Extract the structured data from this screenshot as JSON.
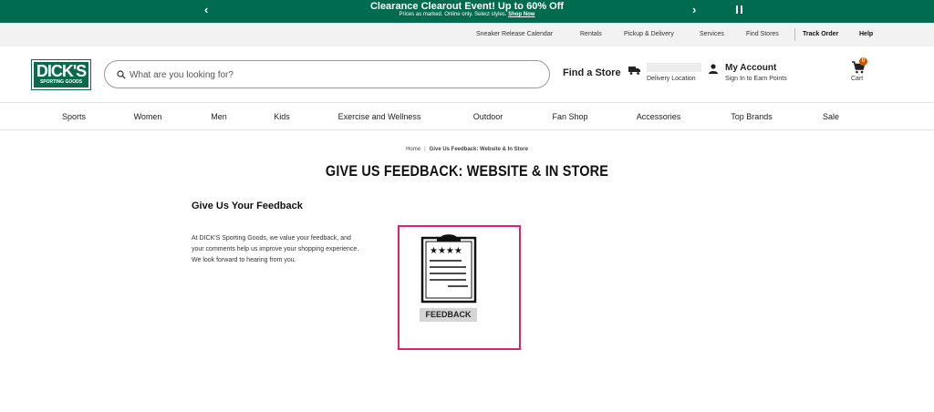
{
  "promo": {
    "title": "Clearance Clearout Event! Up to 60% Off",
    "subtitle": "Prices as marked. Online only. Select styles.",
    "link": "Shop Now",
    "prev": "‹",
    "next": "›"
  },
  "utility": {
    "items": [
      "Sneaker Release Calendar",
      "Rentals",
      "Pickup & Delivery",
      "Services",
      "Find Stores"
    ],
    "track_order": "Track Order",
    "help": "Help"
  },
  "header": {
    "logo_text": "DICK'S",
    "logo_sub": "SPORTING GOODS",
    "search_placeholder": "What are you looking for?",
    "find_store": "Find a Store",
    "delivery_label": "Delivery Location",
    "account_title": "My Account",
    "account_sub": "Sign In to Earn Points",
    "cart_label": "Cart",
    "cart_count": "0"
  },
  "nav": {
    "items": [
      "Sports",
      "Women",
      "Men",
      "Kids",
      "Exercise and Wellness",
      "Outdoor",
      "Fan Shop",
      "Accessories",
      "Top Brands",
      "Sale"
    ]
  },
  "content": {
    "breadcrumb_home": "Home",
    "breadcrumb_sep": "|",
    "breadcrumb_current": "Give Us Feedback: Website & In Store",
    "title": "GIVE US FEEDBACK: WEBSITE & IN STORE",
    "section_heading": "Give Us Your Feedback",
    "description": "At DICK'S Sporting Goods, we value your feedback, and your comments help us improve your shopping experience. We look forward to hearing from you.",
    "card_label": "FEEDBACK"
  },
  "colors": {
    "brand_green": "#006b4e",
    "card_border": "#e0246c",
    "cart_badge": "#d45500"
  }
}
